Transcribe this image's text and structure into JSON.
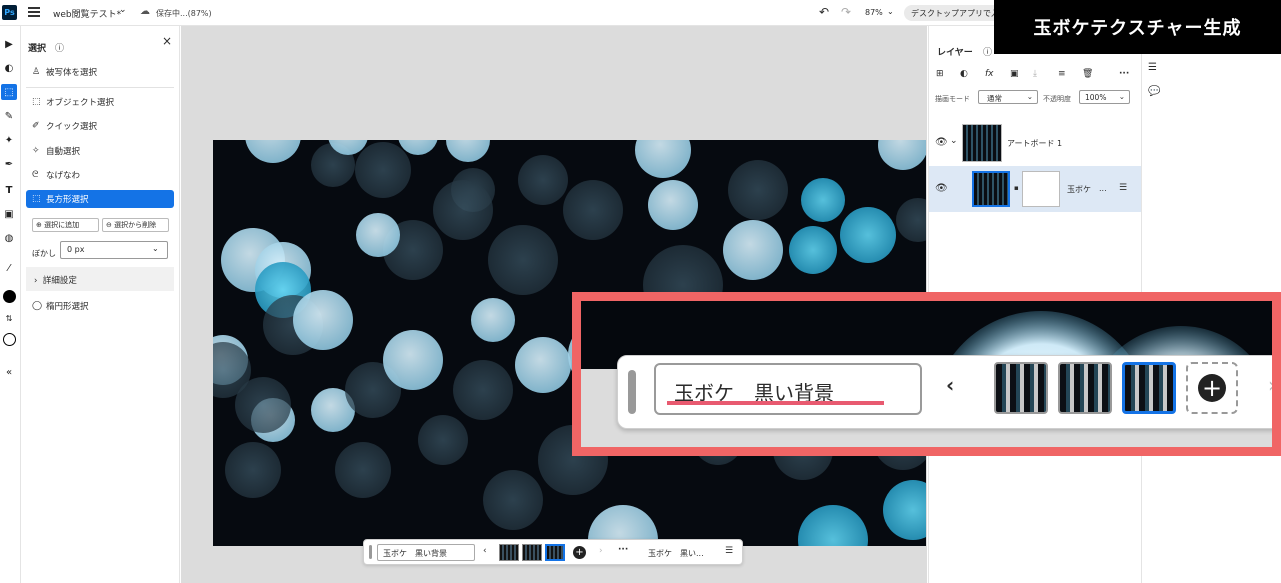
{
  "topbar": {
    "app_logo": "Ps",
    "doc_title": "web閲覧テスト*",
    "save_status": "保存中...(87%)",
    "zoom": "87%",
    "desktop_button": "デスクトップアプリで入"
  },
  "banner": {
    "title": "玉ボケテクスチャー生成"
  },
  "toolbar": {
    "tools": [
      "select-arrow-icon",
      "quick-mask-icon",
      "rect-marquee-icon",
      "healing-icon",
      "generative-fill-icon",
      "brush-icon",
      "type-icon",
      "image-icon",
      "adjust-icon",
      "eyedropper-icon",
      "foreground-color",
      "swap-icon",
      "background-color",
      "collapse-icon"
    ]
  },
  "select_panel": {
    "title": "選択",
    "subject": "被写体を選択",
    "object": "オブジェクト選択",
    "quick": "クイック選択",
    "auto": "自動選択",
    "lasso": "なげなわ",
    "rect": "長方形選択",
    "add": "選択に追加",
    "subtract": "選択から削除",
    "feather_label": "ぼかし",
    "feather_value": "0 px",
    "advanced": "詳細設定",
    "ellipse": "楕円形選択"
  },
  "context_bar": {
    "prompt": "玉ボケ　黒い背景",
    "label": "玉ボケ　黒い..."
  },
  "layers": {
    "title": "レイヤー",
    "blend_label": "描画モード",
    "blend_value": "通常",
    "opacity_label": "不透明度",
    "opacity_value": "100%",
    "artboard_name": "アートボード 1",
    "layer_name": "玉ボケ",
    "layer_more": "..."
  },
  "zoom": {
    "prompt": "玉ボケ　黒い背景"
  },
  "colors": {
    "accent": "#1473e6",
    "callout": "#f06565"
  }
}
